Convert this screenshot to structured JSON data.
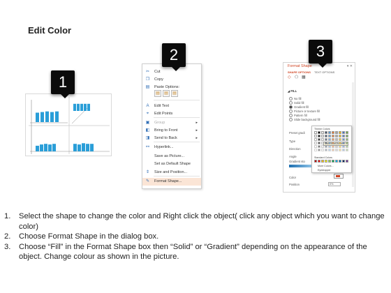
{
  "title": "Edit Color",
  "badges": {
    "one": "1",
    "two": "2",
    "three": "3"
  },
  "chart": {
    "bar_color": "#2a9ed8",
    "left_top_bars": [
      0.75,
      0.8,
      0.85,
      0.8,
      0.85
    ],
    "right_top_bars": [
      0.85,
      0.85,
      0.85,
      0.85,
      0.85
    ],
    "left_bottom_bars": [
      0.45,
      0.55,
      0.6,
      0.55,
      0.6
    ],
    "right_bottom_bars": [
      0.6,
      0.55,
      0.65,
      0.6,
      0.6
    ]
  },
  "context_menu": {
    "items": [
      {
        "icon": "cut-icon",
        "glyph": "✂",
        "label": "Cut"
      },
      {
        "icon": "copy-icon",
        "glyph": "❐",
        "label": "Copy"
      },
      {
        "icon": "paste-icon",
        "glyph": "▤",
        "label": "Paste Options:"
      },
      {
        "icon": "edit-text-icon",
        "glyph": "A",
        "label": "Edit Text"
      },
      {
        "icon": "edit-points-icon",
        "glyph": "⌖",
        "label": "Edit Points"
      },
      {
        "icon": "group-icon",
        "glyph": "▣",
        "label": "Group"
      },
      {
        "icon": "bring-to-front-icon",
        "glyph": "◧",
        "label": "Bring to Front"
      },
      {
        "icon": "send-to-back-icon",
        "glyph": "◨",
        "label": "Send to Back"
      },
      {
        "icon": "hyperlink-icon",
        "glyph": "⚯",
        "label": "Hyperlink..."
      },
      {
        "icon": "save-picture-icon",
        "glyph": "",
        "label": "Save as Picture..."
      },
      {
        "icon": "default-shape-icon",
        "glyph": "",
        "label": "Set as Default Shape"
      },
      {
        "icon": "size-position-icon",
        "glyph": "⇕",
        "label": "Size and Position..."
      },
      {
        "icon": "format-shape-icon",
        "glyph": "✎",
        "label": "Format Shape..."
      }
    ],
    "highlight_color": "#fbe5d6"
  },
  "format_pane": {
    "title": "Format Shape",
    "close": "▾ ✕",
    "tabs": [
      "SHAPE OPTIONS",
      "TEXT OPTIONS"
    ],
    "section": "◢ FILL",
    "fill_options": [
      "No fill",
      "Solid fill",
      "Gradient fill",
      "Picture or texture fill",
      "Pattern fill",
      "Slide background fill"
    ],
    "selected_fill": "Gradient fill",
    "fields": [
      "Preset gradi",
      "Type",
      "Direction",
      "Angle",
      "Gradient sto"
    ],
    "color_label": "Color",
    "position_label": "Position",
    "position_value": "0%",
    "accent": "#d04423",
    "palette": {
      "theme_label": "Theme Colors",
      "standard_label": "Standard Colors",
      "tooltip": "Dark Blue, Accent 1",
      "more": "More Colors...",
      "eyedropper": "Eyedropper"
    }
  },
  "instructions": [
    {
      "num": "1.",
      "text": "Select the shape to change the color and Right click the object( click any object which you want to change color)"
    },
    {
      "num": "2.",
      "text": "Choose Format Shape in the dialog box."
    },
    {
      "num": "3.",
      "text": "Choose “Fill” in the Format Shape box then “Solid” or “Gradient” depending on the appearance of the object. Change colour as shown in the picture."
    }
  ]
}
